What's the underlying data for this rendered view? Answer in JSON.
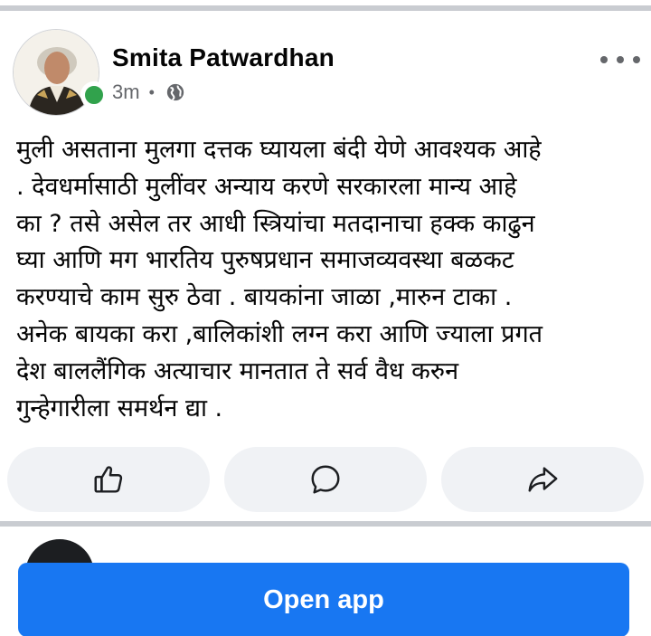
{
  "post": {
    "author": "Smita Patwardhan",
    "time": "3m",
    "separator": "•",
    "audience_icon": "globe-icon",
    "online": true,
    "body": "मुली असताना मुलगा दत्तक घ्यायला बंदी येणे आवश्यक आहे\n. देवधर्मासाठी मुलींवर अन्याय करणे सरकारला मान्य आहे\nका ? तसे असेल तर आधी स्त्रियांचा मतदानाचा हक्क काढुन\nघ्या आणि मग भारतिय पुरुषप्रधान समाजव्यवस्था बळकट\nकरण्याचे काम सुरु ठेवा . बायकांना जाळा ,मारुन टाका .\nअनेक बायका करा ,बालिकांशी लग्न करा आणि ज्याला प्रगत\nदेश बाललैंगिक अत्याचार मानतात ते सर्व वैध करुन\nगुन्हेगारीला समर्थन द्या .",
    "actions": [
      {
        "name": "like-button",
        "icon": "thumbs-up-icon"
      },
      {
        "name": "comment-button",
        "icon": "comment-icon"
      },
      {
        "name": "share-button",
        "icon": "share-icon"
      }
    ]
  },
  "colors": {
    "brand": "#1877f2",
    "online": "#31a24c",
    "secondary_text": "#65676b",
    "action_bg": "#f0f2f5",
    "separator": "#c9ccd1"
  },
  "footer": {
    "open_app_label": "Open app"
  }
}
